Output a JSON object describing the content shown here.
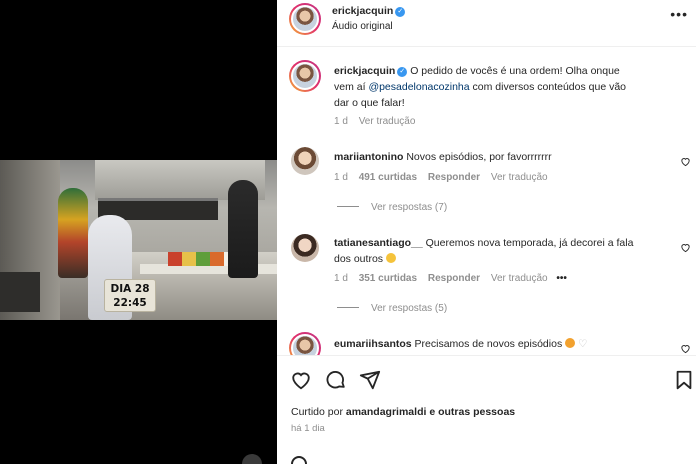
{
  "video": {
    "timestamp_day": "DIA 28",
    "timestamp_time": "22:45"
  },
  "header": {
    "username": "erickjacquin",
    "subtitle": "Áudio original",
    "more": "•••"
  },
  "caption": {
    "username": "erickjacquin",
    "line1": "O pedido de vocês é una ordem! Olha onque",
    "line2_pre": "vem aí",
    "mention": "@pesadelonacozinha",
    "line2_post": "com diversos conteúdos que vão",
    "line3": "dar o que falar!",
    "time": "1 d",
    "translate": "Ver tradução"
  },
  "comments": [
    {
      "username": "mariiantonino",
      "text": "Novos episódios, por favorrrrrrr",
      "time": "1 d",
      "likes": "491 curtidas",
      "reply": "Responder",
      "translate": "Ver tradução",
      "replies": "Ver respostas (7)"
    },
    {
      "username": "tatianesantiago__",
      "text_line1": "Queremos nova temporada, já decorei a fala",
      "text_line2": "dos outros",
      "time": "1 d",
      "likes": "351 curtidas",
      "reply": "Responder",
      "translate": "Ver tradução",
      "more": "•••",
      "replies": "Ver respostas (5)"
    },
    {
      "username": "eumariihsantos",
      "text": "Precisamos de novos episódios"
    }
  ],
  "footer": {
    "liked_by_prefix": "Curtido por",
    "liked_by_user": "amandagrimaldi",
    "liked_by_suffix": "e outras pessoas",
    "time": "há 1 dia"
  },
  "icons": [
    "heart-icon",
    "comment-icon",
    "share-icon",
    "bookmark-icon",
    "verified-badge-icon",
    "more-options-icon"
  ],
  "colors": {
    "verified": "#3897f0",
    "mention": "#00376b",
    "muted": "#8e8e8e"
  }
}
